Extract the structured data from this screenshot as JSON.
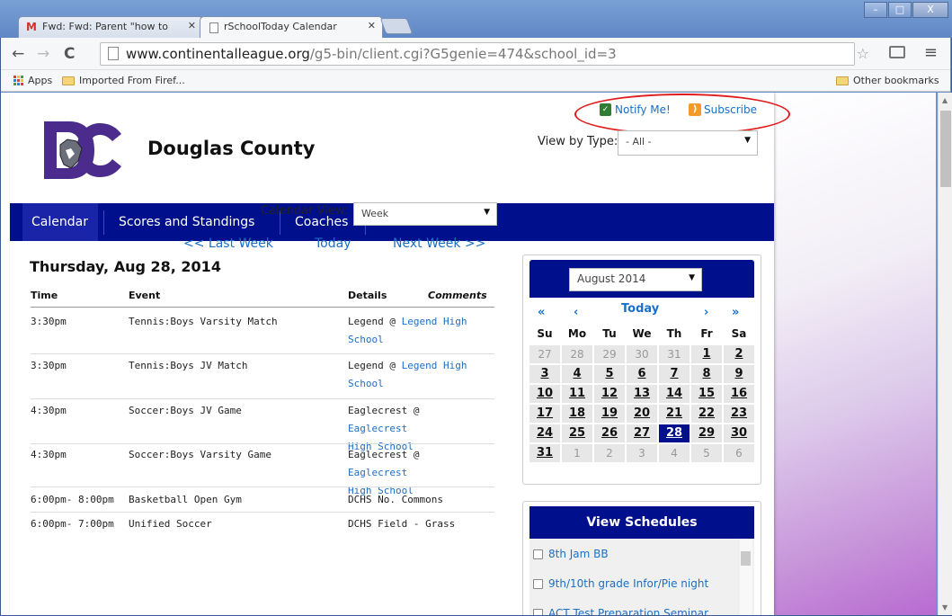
{
  "browser": {
    "tabs": [
      {
        "label": "Fwd: Fwd: Parent \"how to",
        "icon": "gmail-icon"
      },
      {
        "label": "rSchoolToday Calendar",
        "icon": "page-icon"
      }
    ],
    "url_host": "www.continentalleague.org",
    "url_path": "/g5-bin/client.cgi?G5genie=474&school_id=3",
    "bookmarks": {
      "apps": "Apps",
      "imported": "Imported From Firef...",
      "other": "Other bookmarks"
    },
    "window_buttons": [
      "–",
      "□",
      "X"
    ]
  },
  "header": {
    "school_name": "Douglas County",
    "notify": "Notify Me!",
    "subscribe": "Subscribe",
    "view_type_label": "View by Type:",
    "view_type_value": "- All -"
  },
  "nav": {
    "items": [
      "Calendar",
      "Scores and Standings",
      "Coaches"
    ]
  },
  "calendar": {
    "view_label": "Calendar View:",
    "view_value": "Week",
    "last_week": "<< Last Week",
    "today": "Today",
    "next_week": "Next Week >>",
    "day_heading": "Thursday, Aug 28, 2014",
    "columns": {
      "time": "Time",
      "event": "Event",
      "details": "Details",
      "comments": "Comments"
    },
    "events": [
      {
        "time": "3:30pm",
        "event": "Tennis:Boys Varsity Match",
        "detail": "Legend @ ",
        "link": "Legend High",
        "link2": "School"
      },
      {
        "time": "3:30pm",
        "event": "Tennis:Boys JV Match",
        "detail": "Legend @ ",
        "link": "Legend High",
        "link2": "School"
      },
      {
        "time": "4:30pm",
        "event": "Soccer:Boys JV Game",
        "detail": "Eaglecrest @ ",
        "link": "Eaglecrest",
        "link2": "High School"
      },
      {
        "time": "4:30pm",
        "event": "Soccer:Boys Varsity Game",
        "detail": "Eaglecrest @ ",
        "link": "Eaglecrest",
        "link2": "High School"
      },
      {
        "time": "6:00pm- 8:00pm",
        "event": "Basketball Open Gym",
        "detail": "DCHS No. Commons",
        "link": "",
        "link2": ""
      },
      {
        "time": "6:00pm- 7:00pm",
        "event": "Unified Soccer",
        "detail": "DCHS Field - Grass",
        "link": "",
        "link2": ""
      }
    ]
  },
  "mini_calendar": {
    "month_value": "August 2014",
    "prev_year": "«",
    "prev_month": "‹",
    "today": "Today",
    "next_month": "›",
    "next_year": "»",
    "dow": [
      "Su",
      "Mo",
      "Tu",
      "We",
      "Th",
      "Fr",
      "Sa"
    ],
    "days": [
      {
        "d": "27",
        "t": "other"
      },
      {
        "d": "28",
        "t": "other"
      },
      {
        "d": "29",
        "t": "other"
      },
      {
        "d": "30",
        "t": "other"
      },
      {
        "d": "31",
        "t": "other"
      },
      {
        "d": "1",
        "t": "cur"
      },
      {
        "d": "2",
        "t": "cur"
      },
      {
        "d": "3",
        "t": "cur"
      },
      {
        "d": "4",
        "t": "cur"
      },
      {
        "d": "5",
        "t": "cur"
      },
      {
        "d": "6",
        "t": "cur"
      },
      {
        "d": "7",
        "t": "cur"
      },
      {
        "d": "8",
        "t": "cur"
      },
      {
        "d": "9",
        "t": "cur"
      },
      {
        "d": "10",
        "t": "cur"
      },
      {
        "d": "11",
        "t": "cur"
      },
      {
        "d": "12",
        "t": "cur"
      },
      {
        "d": "13",
        "t": "cur"
      },
      {
        "d": "14",
        "t": "cur"
      },
      {
        "d": "15",
        "t": "cur"
      },
      {
        "d": "16",
        "t": "cur"
      },
      {
        "d": "17",
        "t": "cur"
      },
      {
        "d": "18",
        "t": "cur"
      },
      {
        "d": "19",
        "t": "cur"
      },
      {
        "d": "20",
        "t": "cur"
      },
      {
        "d": "21",
        "t": "cur"
      },
      {
        "d": "22",
        "t": "cur"
      },
      {
        "d": "23",
        "t": "cur"
      },
      {
        "d": "24",
        "t": "cur"
      },
      {
        "d": "25",
        "t": "cur"
      },
      {
        "d": "26",
        "t": "cur"
      },
      {
        "d": "27",
        "t": "cur"
      },
      {
        "d": "28",
        "t": "today"
      },
      {
        "d": "29",
        "t": "cur"
      },
      {
        "d": "30",
        "t": "cur"
      },
      {
        "d": "31",
        "t": "cur"
      },
      {
        "d": "1",
        "t": "other"
      },
      {
        "d": "2",
        "t": "other"
      },
      {
        "d": "3",
        "t": "other"
      },
      {
        "d": "4",
        "t": "other"
      },
      {
        "d": "5",
        "t": "other"
      },
      {
        "d": "6",
        "t": "other"
      }
    ]
  },
  "schedules": {
    "title": "View Schedules",
    "items": [
      "8th Jam BB",
      "9th/10th grade Infor/Pie night",
      "ACT Test Preparation Seminar"
    ]
  },
  "colors": {
    "brand_navy": "#000f8c",
    "link_blue": "#1a6fc9",
    "highlight_red": "#e01b1b"
  }
}
